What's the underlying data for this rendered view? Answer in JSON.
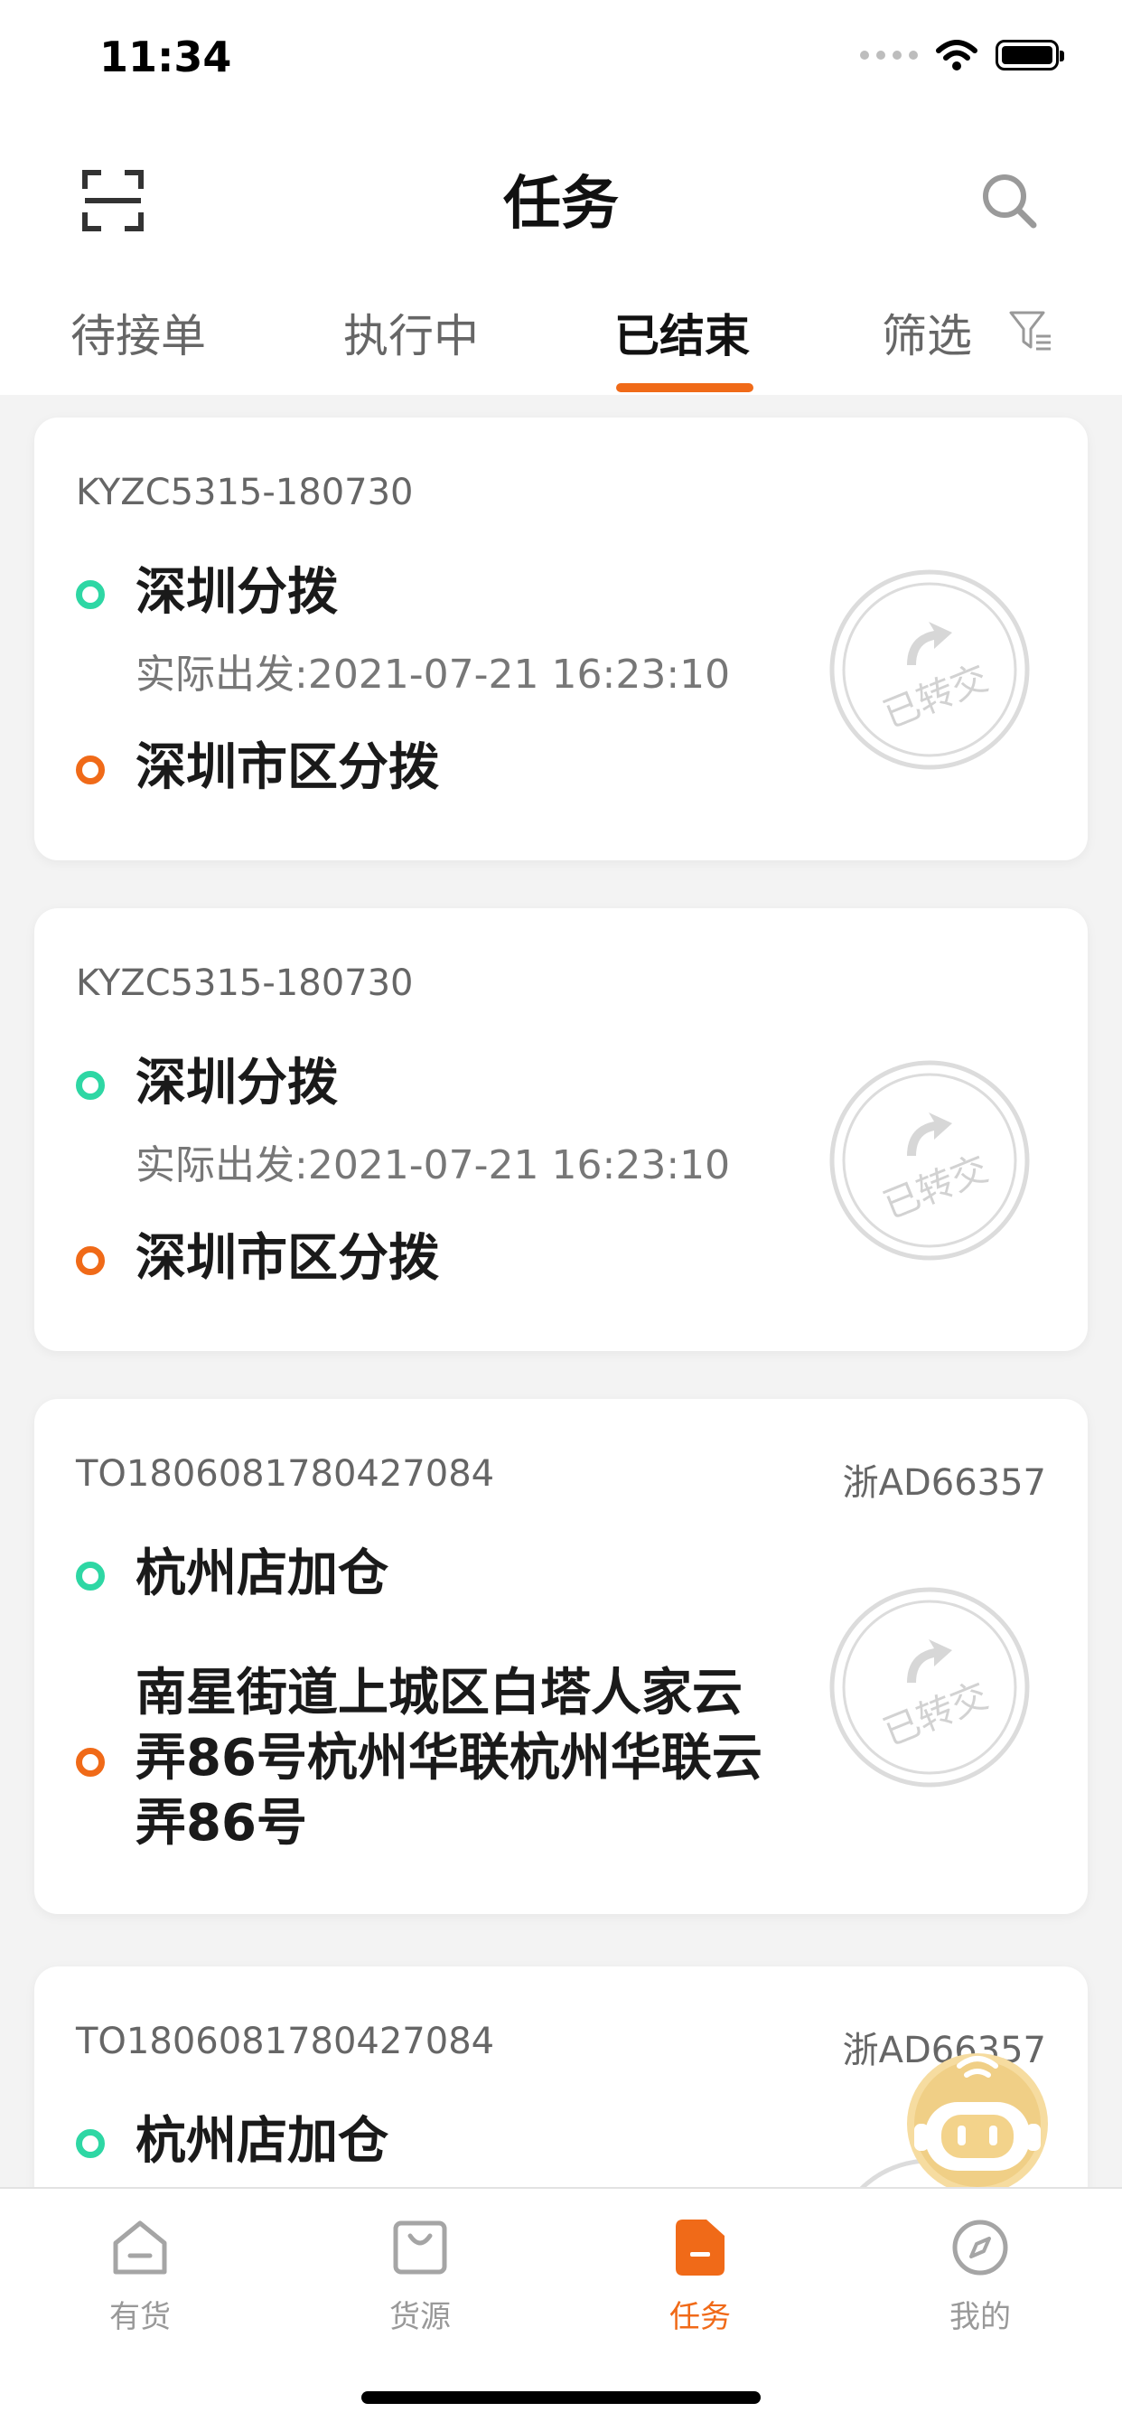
{
  "status": {
    "time": "11:34"
  },
  "header": {
    "title": "任务",
    "scan_icon": "scan-icon",
    "search_icon": "search-icon"
  },
  "tabs": [
    "待接单",
    "执行中",
    "已结束",
    "筛选"
  ],
  "active_tab": "已结束",
  "accent_color": "#f06a18",
  "cards": [
    {
      "order_no": "KYZC5315-180730",
      "plate": "",
      "from": "深圳分拨",
      "departure": "实际出发:2021-07-21 16:23:10",
      "to": "深圳市区分拨",
      "stamp": "已转交"
    },
    {
      "order_no": "KYZC5315-180730",
      "plate": "",
      "from": "深圳分拨",
      "departure": "实际出发:2021-07-21 16:23:10",
      "to": "深圳市区分拨",
      "stamp": "已转交"
    },
    {
      "order_no": "TO1806081780427084",
      "plate": "浙AD66357",
      "from": "杭州店加仓",
      "departure": "",
      "to": "南星街道上城区白塔人家云弄86号杭州华联杭州华联云弄86号",
      "stamp": "已转交"
    },
    {
      "order_no": "TO1806081780427084",
      "plate": "浙AD66357",
      "from": "杭州店加仓",
      "departure": "",
      "to": "",
      "stamp": ""
    }
  ],
  "bottom_nav": [
    {
      "label": "有货",
      "icon": "home-icon"
    },
    {
      "label": "货源",
      "icon": "bag-icon"
    },
    {
      "label": "任务",
      "icon": "task-icon"
    },
    {
      "label": "我的",
      "icon": "compass-icon"
    }
  ]
}
